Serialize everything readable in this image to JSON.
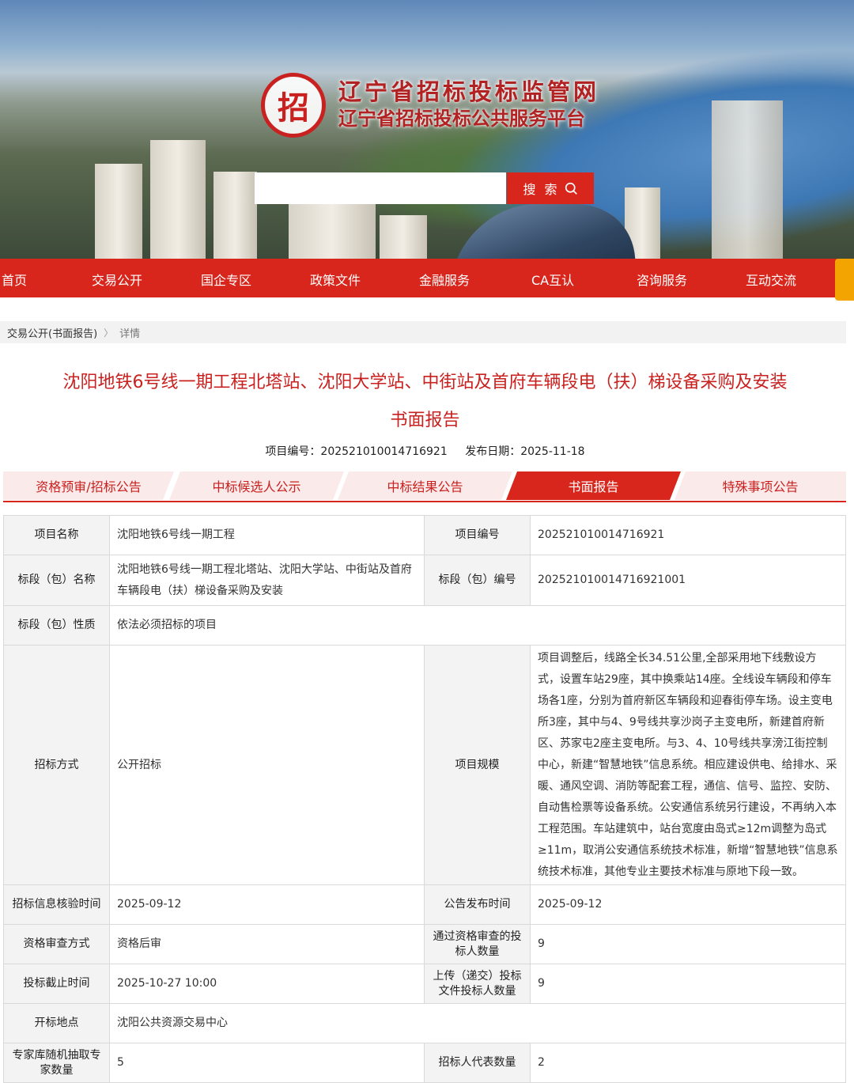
{
  "header": {
    "site_title": "辽宁省招标投标监管网",
    "site_subtitle": "辽宁省招标投标公共服务平台",
    "seal_char": "招",
    "search": {
      "placeholder": "",
      "button_label": "搜 索"
    }
  },
  "nav": {
    "items": [
      "首页",
      "交易公开",
      "国企专区",
      "政策文件",
      "金融服务",
      "CA互认",
      "咨询服务",
      "互动交流"
    ]
  },
  "breadcrumb": {
    "parent": "交易公开(书面报告)",
    "separator": "〉",
    "current": "详情"
  },
  "page": {
    "title_line1": "沈阳地铁6号线一期工程北塔站、沈阳大学站、中街站及首府车辆段电（扶）梯设备采购及安装",
    "title_line2": "书面报告",
    "project_no_label": "项目编号：",
    "project_no": "202521010014716921",
    "publish_date_label": "发布日期：",
    "publish_date": "2025-11-18"
  },
  "tabs": [
    "资格预审/招标公告",
    "中标候选人公示",
    "中标结果公告",
    "书面报告",
    "特殊事项公告"
  ],
  "active_tab": "书面报告",
  "table": {
    "project_name_label": "项目名称",
    "project_name": "沈阳地铁6号线一期工程",
    "project_no_label": "项目编号",
    "project_no": "202521010014716921",
    "section_name_label": "标段（包）名称",
    "section_name": "沈阳地铁6号线一期工程北塔站、沈阳大学站、中街站及首府车辆段电（扶）梯设备采购及安装",
    "section_no_label": "标段（包）编号",
    "section_no": "202521010014716921001",
    "section_nature_label": "标段（包）性质",
    "section_nature": "依法必须招标的项目",
    "bid_method_label": "招标方式",
    "bid_method": "公开招标",
    "project_scale_label": "项目规模",
    "project_scale": "项目调整后，线路全长34.51公里,全部采用地下线敷设方式，设置车站29座，其中换乘站14座。全线设车辆段和停车场各1座，分别为首府新区车辆段和迎春街停车场。设主变电所3座，其中与4、9号线共享沙岗子主变电所，新建首府新区、苏家屯2座主变电所。与3、4、10号线共享滂江街控制中心，新建“智慧地铁”信息系统。相应建设供电、给排水、采暖、通风空调、消防等配套工程，通信、信号、监控、安防、自动售检票等设备系统。公安通信系统另行建设，不再纳入本工程范围。车站建筑中，站台宽度由岛式≥12m调整为岛式≥11m，取消公安通信系统技术标准，新增“智慧地铁”信息系统技术标准，其他专业主要技术标准与原地下段一致。",
    "verify_time_label": "招标信息核验时间",
    "verify_time": "2025-09-12",
    "announce_time_label": "公告发布时间",
    "announce_time": "2025-09-12",
    "qualify_method_label": "资格审查方式",
    "qualify_method": "资格后审",
    "qualified_count_label": "通过资格审查的投标人数量",
    "qualified_count": "9",
    "deadline_label": "投标截止时间",
    "deadline": "2025-10-27 10:00",
    "submitted_count_label": "上传（递交）投标文件投标人数量",
    "submitted_count": "9",
    "open_place_label": "开标地点",
    "open_place": "沈阳公共资源交易中心",
    "expert_count_label": "专家库随机抽取专家数量",
    "expert_count": "5",
    "rep_count_label": "招标人代表数量",
    "rep_count": "2"
  },
  "colors": {
    "brand_red": "#d9261c",
    "title_red": "#c8211f",
    "accent_orange": "#f4a400"
  }
}
